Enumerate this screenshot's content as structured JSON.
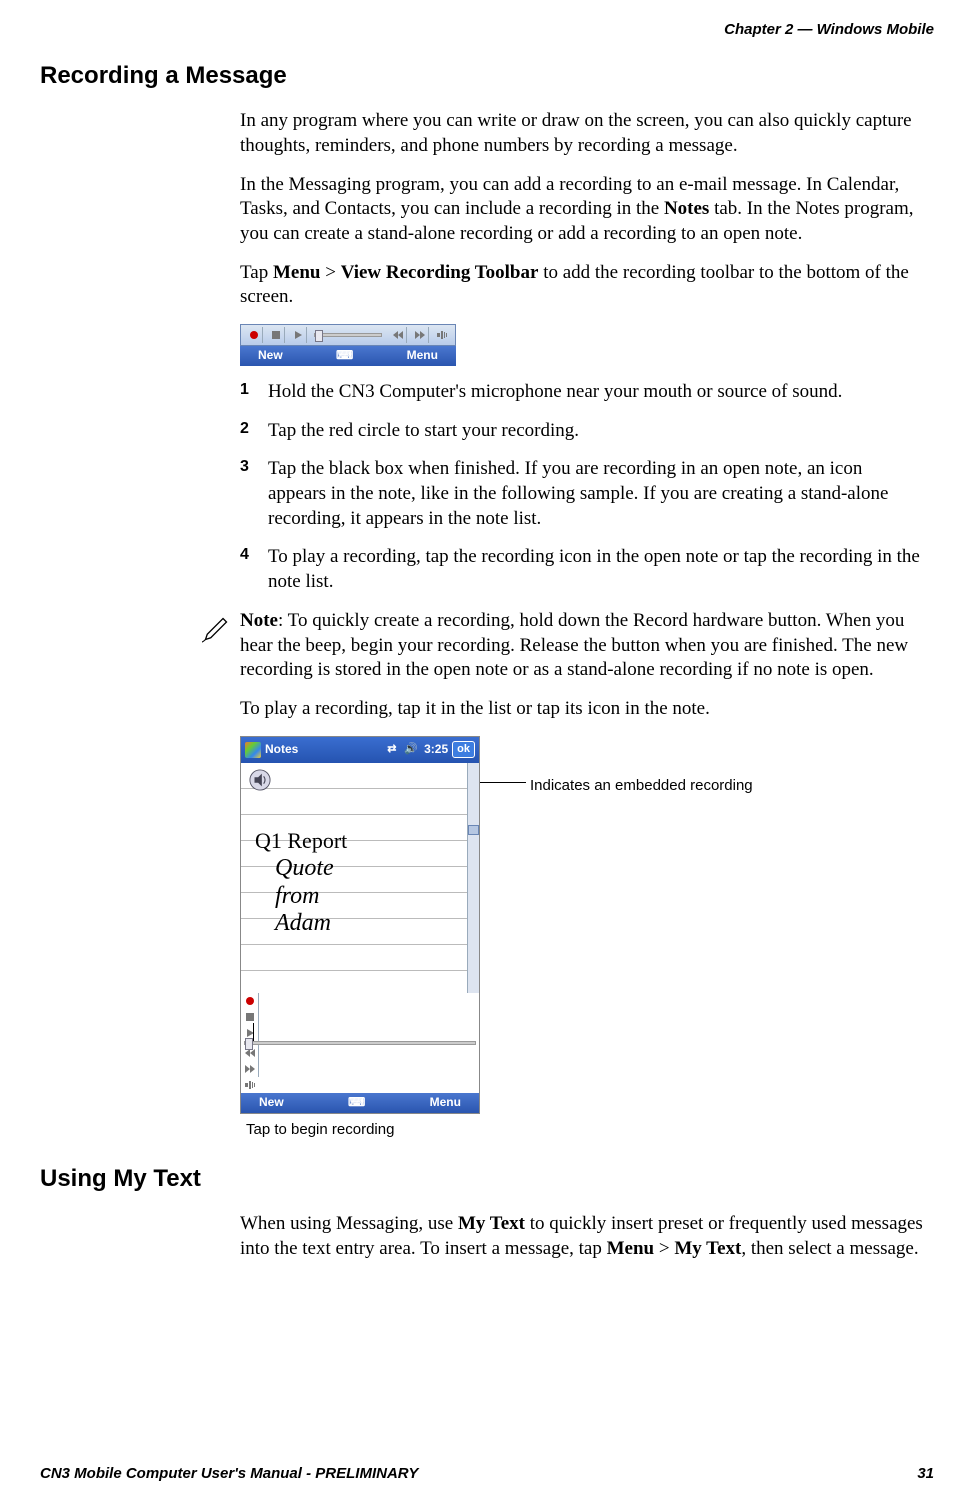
{
  "header": {
    "chapter": "Chapter 2 —  Windows Mobile"
  },
  "section1": {
    "heading": "Recording a Message",
    "para1": "In any program where you can write or draw on the screen, you can also quickly capture thoughts, reminders, and phone numbers by recording a message.",
    "para2_a": "In the Messaging program, you can add a recording to an e-mail message. In Calendar, Tasks, and Contacts, you can include a recording in the ",
    "para2_bold1": "Notes",
    "para2_b": " tab. In the Notes program, you can create a stand-alone recording or add a recording to an open note.",
    "para3_a": "Tap ",
    "para3_bold1": "Menu",
    "para3_b": " > ",
    "para3_bold2": "View Recording Toolbar",
    "para3_c": " to add the recording toolbar to the bottom of the screen.",
    "steps": [
      "Hold the CN3 Computer's microphone near your mouth or source of sound.",
      "Tap the red circle to start your recording.",
      "Tap the black box when finished. If you are recording in an open note, an icon appears in the note, like in the following sample. If you are creating a stand-alone recording, it appears in the note list.",
      "To play a recording, tap the recording icon in the open note or tap the recording in the note list."
    ],
    "note_bold": "Note",
    "note_text": ": To quickly create a recording, hold down the Record hardware button. When you hear the beep, begin your recording. Release the button when you are finished. The new recording is stored in the open note or as a stand-alone recording if no note is open.",
    "para_play": "To play a recording, tap it in the list or tap its icon in the note."
  },
  "toolbar": {
    "new_label": "New",
    "menu_label": "Menu"
  },
  "screenshot": {
    "app_title": "Notes",
    "time": "3:25",
    "ok": "ok",
    "handwriting_title": "Q1 Report",
    "handwriting_body": "Quote\nfrom\nAdam",
    "callout_embedded": "Indicates an embedded recording",
    "caption_tap": "Tap to begin recording",
    "softkey_new": "New",
    "softkey_menu": "Menu"
  },
  "section2": {
    "heading": "Using My Text",
    "para_a": "When using Messaging, use ",
    "para_bold1": "My Text",
    "para_b": " to quickly insert preset or frequently used messages into the text entry area. To insert a message, tap ",
    "para_bold2": "Menu",
    "para_c": " > ",
    "para_bold3": "My Text",
    "para_d": ", then select a message."
  },
  "footer": {
    "left": "CN3 Mobile Computer User's Manual - PRELIMINARY",
    "right": "31"
  }
}
